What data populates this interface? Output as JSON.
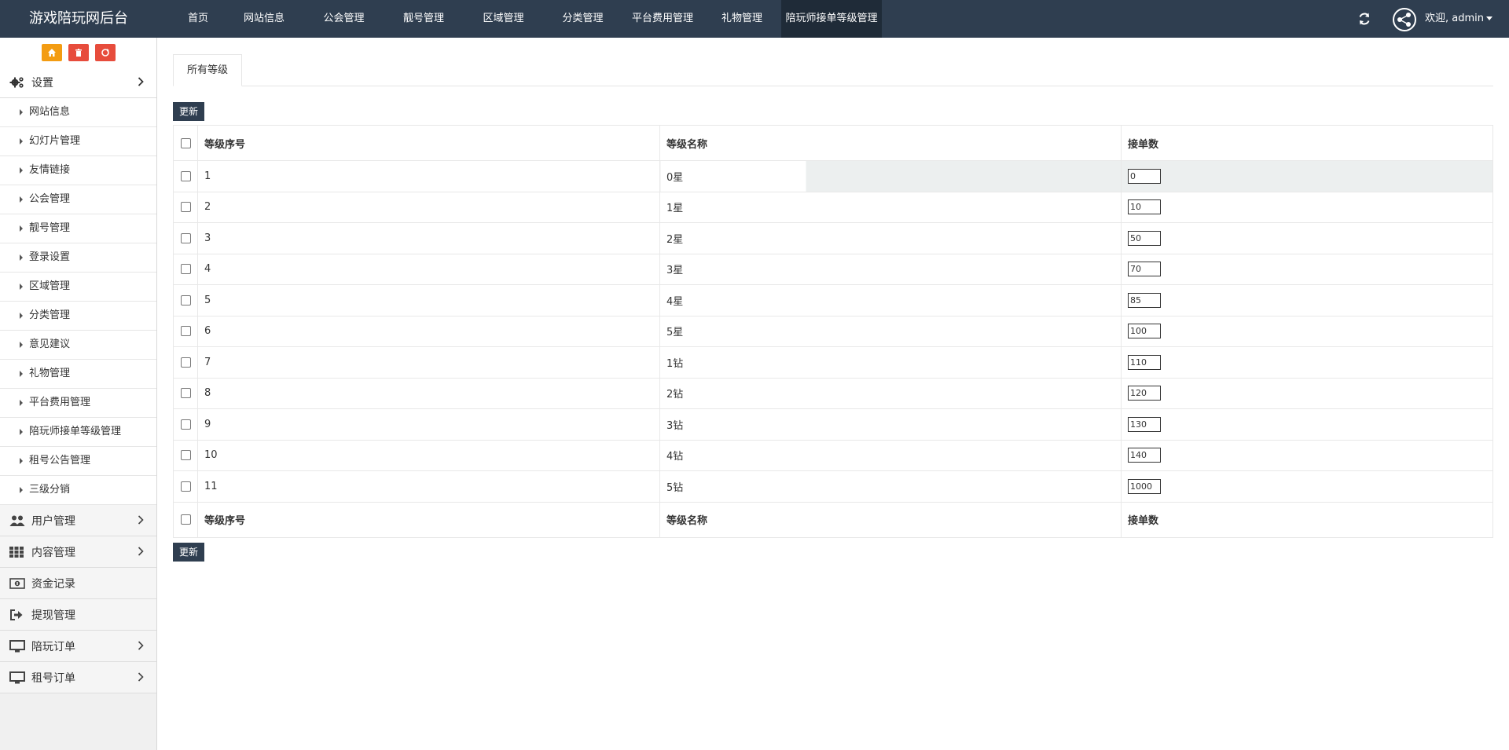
{
  "app": {
    "brand": "游戏陪玩网后台"
  },
  "topnav": [
    {
      "label": "首页",
      "width": 66,
      "active": false
    },
    {
      "label": "网站信息",
      "width": 102,
      "active": false
    },
    {
      "label": "公会管理",
      "width": 101,
      "active": false
    },
    {
      "label": "靓号管理",
      "width": 102,
      "active": false
    },
    {
      "label": "区域管理",
      "width": 101,
      "active": false
    },
    {
      "label": "分类管理",
      "width": 101,
      "active": false
    },
    {
      "label": "平台费用管理",
      "width": 102,
      "active": false
    },
    {
      "label": "礼物管理",
      "width": 100,
      "active": false
    },
    {
      "label": "陪玩师接单等级管理",
      "width": 128,
      "active": true
    }
  ],
  "user": {
    "welcome": "欢迎, admin"
  },
  "icons": {
    "home": "home-icon",
    "trash": "trash-icon",
    "recycle": "recycle-icon",
    "refresh": "refresh-icon",
    "avatar": "share-icon"
  },
  "sidebar": {
    "settings_group": "设置",
    "settings_items": [
      "网站信息",
      "幻灯片管理",
      "友情链接",
      "公会管理",
      "靓号管理",
      "登录设置",
      "区域管理",
      "分类管理",
      "意见建议",
      "礼物管理",
      "平台费用管理",
      "陪玩师接单等级管理",
      "租号公告管理",
      "三级分销"
    ],
    "groups": [
      {
        "label": "用户管理",
        "icon": "users-icon",
        "chevron": true
      },
      {
        "label": "内容管理",
        "icon": "grid-icon",
        "chevron": true
      },
      {
        "label": "资金记录",
        "icon": "money-icon",
        "chevron": false
      },
      {
        "label": "提现管理",
        "icon": "sign-out-icon",
        "chevron": false
      },
      {
        "label": "陪玩订单",
        "icon": "monitor-icon",
        "chevron": true
      },
      {
        "label": "租号订单",
        "icon": "monitor-icon",
        "chevron": true
      }
    ]
  },
  "main": {
    "tab_label": "所有等级",
    "update_label": "更新",
    "columns": [
      "等级序号",
      "等级名称",
      "接单数"
    ],
    "rows": [
      {
        "index": "1",
        "name": "0星",
        "orders": "0"
      },
      {
        "index": "2",
        "name": "1星",
        "orders": "10"
      },
      {
        "index": "3",
        "name": "2星",
        "orders": "50"
      },
      {
        "index": "4",
        "name": "3星",
        "orders": "70"
      },
      {
        "index": "5",
        "name": "4星",
        "orders": "85"
      },
      {
        "index": "6",
        "name": "5星",
        "orders": "100"
      },
      {
        "index": "7",
        "name": "1钻",
        "orders": "110"
      },
      {
        "index": "8",
        "name": "2钻",
        "orders": "120"
      },
      {
        "index": "9",
        "name": "3钻",
        "orders": "130"
      },
      {
        "index": "10",
        "name": "4钻",
        "orders": "140"
      },
      {
        "index": "11",
        "name": "5钻",
        "orders": "1000"
      }
    ]
  },
  "colors": {
    "topbar": "#2f3e50",
    "orange": "#f39c12",
    "red": "#e74c3c"
  }
}
